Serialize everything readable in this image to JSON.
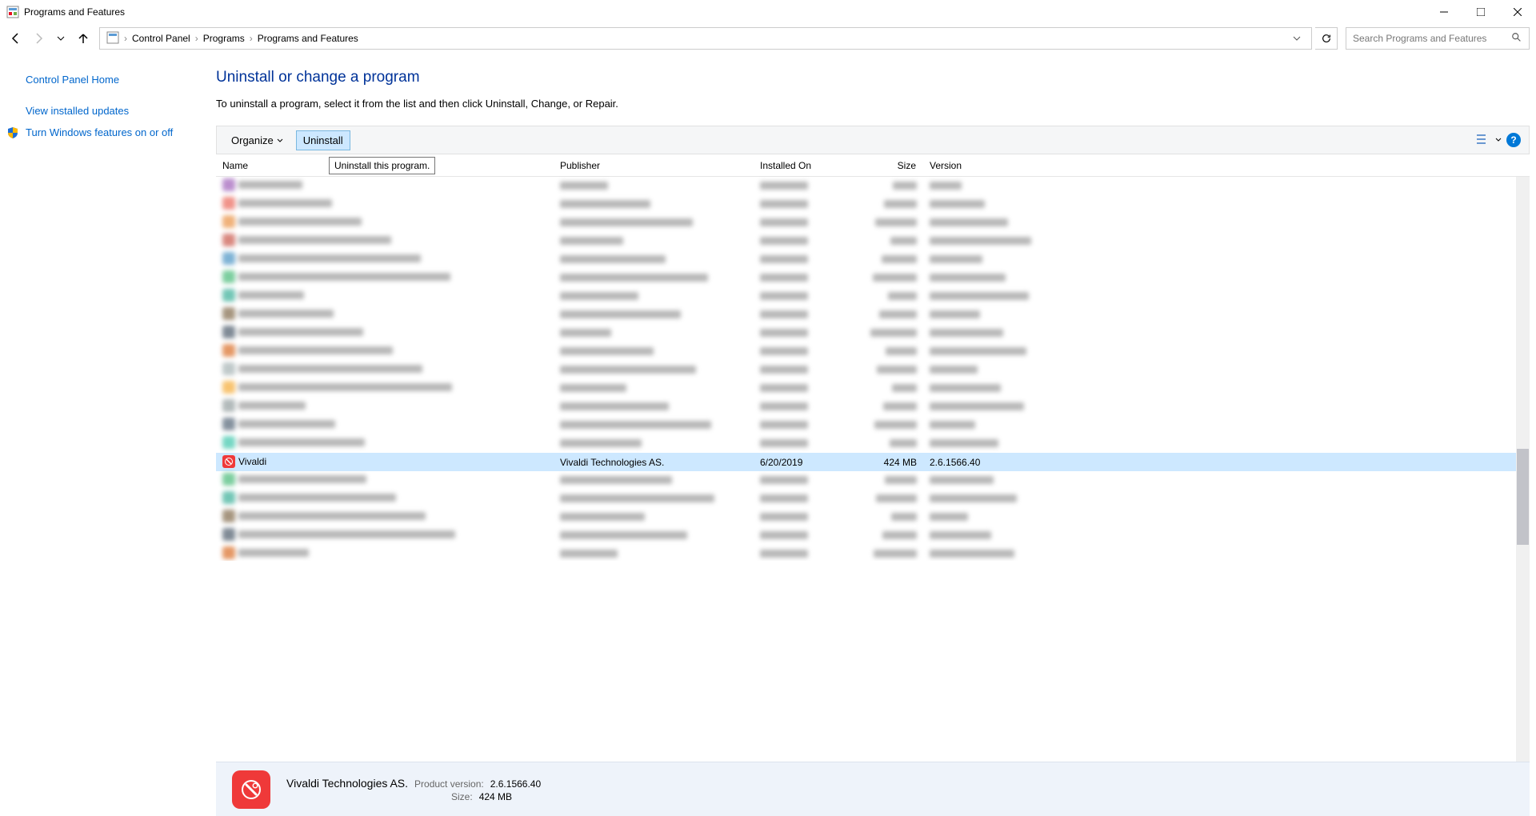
{
  "window": {
    "title": "Programs and Features"
  },
  "breadcrumb": {
    "items": [
      "Control Panel",
      "Programs",
      "Programs and Features"
    ]
  },
  "search": {
    "placeholder": "Search Programs and Features"
  },
  "sidebar": {
    "home": "Control Panel Home",
    "updates": "View installed updates",
    "features": "Turn Windows features on or off"
  },
  "content": {
    "heading": "Uninstall or change a program",
    "description": "To uninstall a program, select it from the list and then click Uninstall, Change, or Repair."
  },
  "toolbar": {
    "organize": "Organize",
    "uninstall": "Uninstall",
    "tooltip": "Uninstall this program."
  },
  "columns": {
    "name": "Name",
    "publisher": "Publisher",
    "installed_on": "Installed On",
    "size": "Size",
    "version": "Version"
  },
  "selected_row": {
    "name": "Vivaldi",
    "publisher": "Vivaldi Technologies AS.",
    "installed_on": "6/20/2019",
    "size": "424 MB",
    "version": "2.6.1566.40",
    "icon_color": "#ef3939"
  },
  "details": {
    "publisher": "Vivaldi Technologies AS.",
    "product_version_label": "Product version:",
    "product_version": "2.6.1566.40",
    "size_label": "Size:",
    "size": "424 MB"
  },
  "blurred_rows_before": 15,
  "blurred_rows_after": 5
}
